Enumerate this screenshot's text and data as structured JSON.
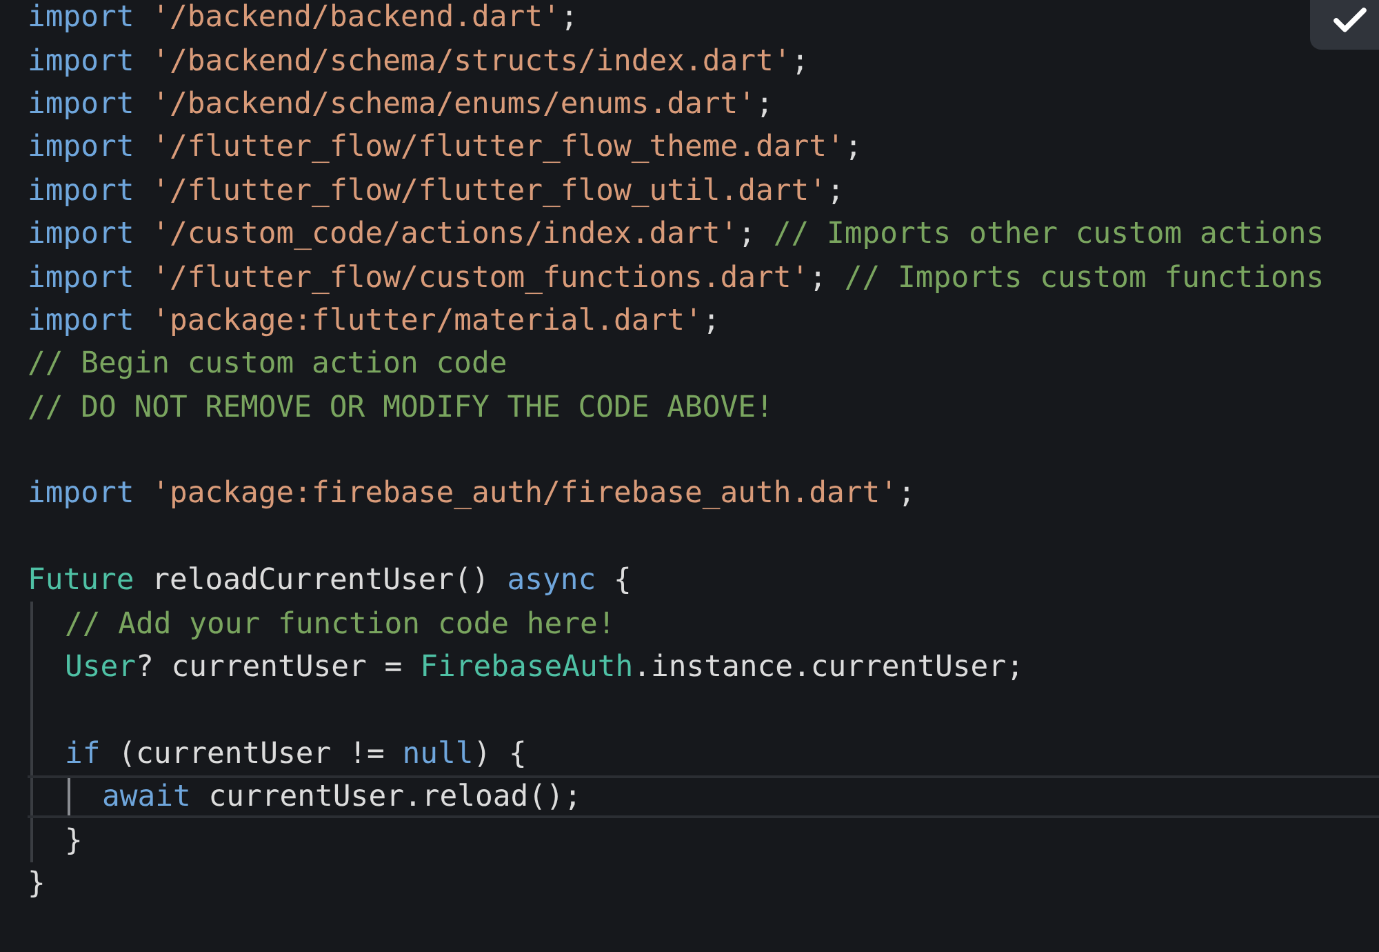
{
  "lines": [
    {
      "kind": "code",
      "tokens": [
        {
          "text": "import ",
          "kind": "keyword"
        },
        {
          "text": "'/backend/backend.dart'",
          "kind": "string"
        },
        {
          "text": ";",
          "kind": "plain"
        }
      ]
    },
    {
      "kind": "code",
      "tokens": [
        {
          "text": "import ",
          "kind": "keyword"
        },
        {
          "text": "'/backend/schema/structs/index.dart'",
          "kind": "string"
        },
        {
          "text": ";",
          "kind": "plain"
        }
      ]
    },
    {
      "kind": "code",
      "tokens": [
        {
          "text": "import ",
          "kind": "keyword"
        },
        {
          "text": "'/backend/schema/enums/enums.dart'",
          "kind": "string"
        },
        {
          "text": ";",
          "kind": "plain"
        }
      ]
    },
    {
      "kind": "code",
      "tokens": [
        {
          "text": "import ",
          "kind": "keyword"
        },
        {
          "text": "'/flutter_flow/flutter_flow_theme.dart'",
          "kind": "string"
        },
        {
          "text": ";",
          "kind": "plain"
        }
      ]
    },
    {
      "kind": "code",
      "tokens": [
        {
          "text": "import ",
          "kind": "keyword"
        },
        {
          "text": "'/flutter_flow/flutter_flow_util.dart'",
          "kind": "string"
        },
        {
          "text": ";",
          "kind": "plain"
        }
      ]
    },
    {
      "kind": "code",
      "tokens": [
        {
          "text": "import ",
          "kind": "keyword"
        },
        {
          "text": "'/custom_code/actions/index.dart'",
          "kind": "string"
        },
        {
          "text": "; ",
          "kind": "plain"
        },
        {
          "text": "// Imports other custom actions",
          "kind": "comment"
        }
      ]
    },
    {
      "kind": "code",
      "tokens": [
        {
          "text": "import ",
          "kind": "keyword"
        },
        {
          "text": "'/flutter_flow/custom_functions.dart'",
          "kind": "string"
        },
        {
          "text": "; ",
          "kind": "plain"
        },
        {
          "text": "// Imports custom functions",
          "kind": "comment"
        }
      ]
    },
    {
      "kind": "code",
      "tokens": [
        {
          "text": "import ",
          "kind": "keyword"
        },
        {
          "text": "'package:flutter/material.dart'",
          "kind": "string"
        },
        {
          "text": ";",
          "kind": "plain"
        }
      ]
    },
    {
      "kind": "code",
      "tokens": [
        {
          "text": "// Begin custom action code",
          "kind": "comment"
        }
      ]
    },
    {
      "kind": "code",
      "tokens": [
        {
          "text": "// DO NOT REMOVE OR MODIFY THE CODE ABOVE!",
          "kind": "comment"
        }
      ]
    },
    {
      "kind": "blank"
    },
    {
      "kind": "code",
      "tokens": [
        {
          "text": "import ",
          "kind": "keyword"
        },
        {
          "text": "'package:firebase_auth/firebase_auth.dart'",
          "kind": "string"
        },
        {
          "text": ";",
          "kind": "plain"
        }
      ]
    },
    {
      "kind": "blank"
    },
    {
      "kind": "code",
      "tokens": [
        {
          "text": "Future",
          "kind": "type"
        },
        {
          "text": " reloadCurrentUser() ",
          "kind": "plain"
        },
        {
          "text": "async",
          "kind": "keyword"
        },
        {
          "text": " {",
          "kind": "plain"
        }
      ],
      "children": [
        {
          "kind": "code",
          "tokens": [
            {
              "text": "// Add your function code here!",
              "kind": "comment"
            }
          ]
        },
        {
          "kind": "code",
          "tokens": [
            {
              "text": "User",
              "kind": "type"
            },
            {
              "text": "? currentUser = ",
              "kind": "plain"
            },
            {
              "text": "FirebaseAuth",
              "kind": "type"
            },
            {
              "text": ".instance.currentUser;",
              "kind": "plain"
            }
          ]
        },
        {
          "kind": "blank"
        },
        {
          "kind": "code",
          "tokens": [
            {
              "text": "if",
              "kind": "keyword"
            },
            {
              "text": " (currentUser != ",
              "kind": "plain"
            },
            {
              "text": "null",
              "kind": "keyword"
            },
            {
              "text": ") {",
              "kind": "plain"
            }
          ],
          "children": [
            {
              "kind": "code",
              "current": true,
              "tokens": [
                {
                  "text": "await",
                  "kind": "keyword"
                },
                {
                  "text": " currentUser.reload();",
                  "kind": "plain"
                }
              ]
            }
          ]
        },
        {
          "kind": "code",
          "tokens": [
            {
              "text": "}",
              "kind": "plain"
            }
          ]
        }
      ]
    },
    {
      "kind": "code",
      "tokens": [
        {
          "text": "}",
          "kind": "plain"
        }
      ]
    }
  ]
}
